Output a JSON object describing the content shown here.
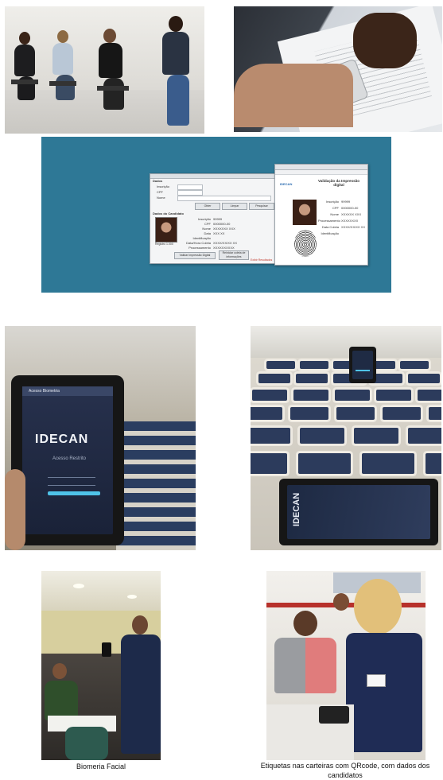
{
  "window_left": {
    "section_top": "Dados",
    "field_inscricao": "Inscrição",
    "field_cpf": "CPF",
    "field_nome": "Nome",
    "button_1": "Obter",
    "button_2": "Limpar",
    "button_3": "Pesquisar",
    "section_candidate": "Dados do Candidato",
    "photo_caption": "Registro 1.000",
    "details": [
      {
        "label": "Inscrição",
        "value": "99999"
      },
      {
        "label": "CPF",
        "value": "0000000-00"
      },
      {
        "label": "Nome",
        "value": "XXXXXXX XXX"
      },
      {
        "label": "Data",
        "value": "XXX XX"
      },
      {
        "label": "Identificação",
        "value": ""
      },
      {
        "label": "Data/Hora Coleta",
        "value": "XXXX/XX/XX XX"
      },
      {
        "label": "Processamento",
        "value": "XXXXXXXXXX"
      }
    ],
    "button_left": "Validar Impressão Digital",
    "button_right": "Reiniciar coleta de informações",
    "status_text": "Exibir Resultados"
  },
  "window_right": {
    "title": "Validação da Impressão digital",
    "brand": "IDECAN",
    "details": [
      {
        "label": "Inscrição",
        "value": "99999"
      },
      {
        "label": "CPF",
        "value": "0000000-00"
      },
      {
        "label": "Nome",
        "value": "XXXXXX XXX"
      },
      {
        "label": "Processamento",
        "value": "XXXXXXXX"
      },
      {
        "label": "Data Coleta",
        "value": "XXXX/XX/XX XX"
      },
      {
        "label": "Identificação",
        "value": ""
      }
    ]
  },
  "tablet_left": {
    "app_bar": "Acesso Biometria",
    "brand": "IDECAN",
    "subtitle": "Acesso Restrito"
  },
  "tablet_right": {
    "brand": "IDECAN"
  },
  "captions": {
    "left": "Biomeria Facial",
    "right": "Etiquetas nas carteiras com QRcode, com dados dos candidatos"
  },
  "colors": {
    "teal_background": "#2e7896",
    "tablet_screen": "#1f2b44",
    "accent_cyan": "#4fc3e8"
  }
}
